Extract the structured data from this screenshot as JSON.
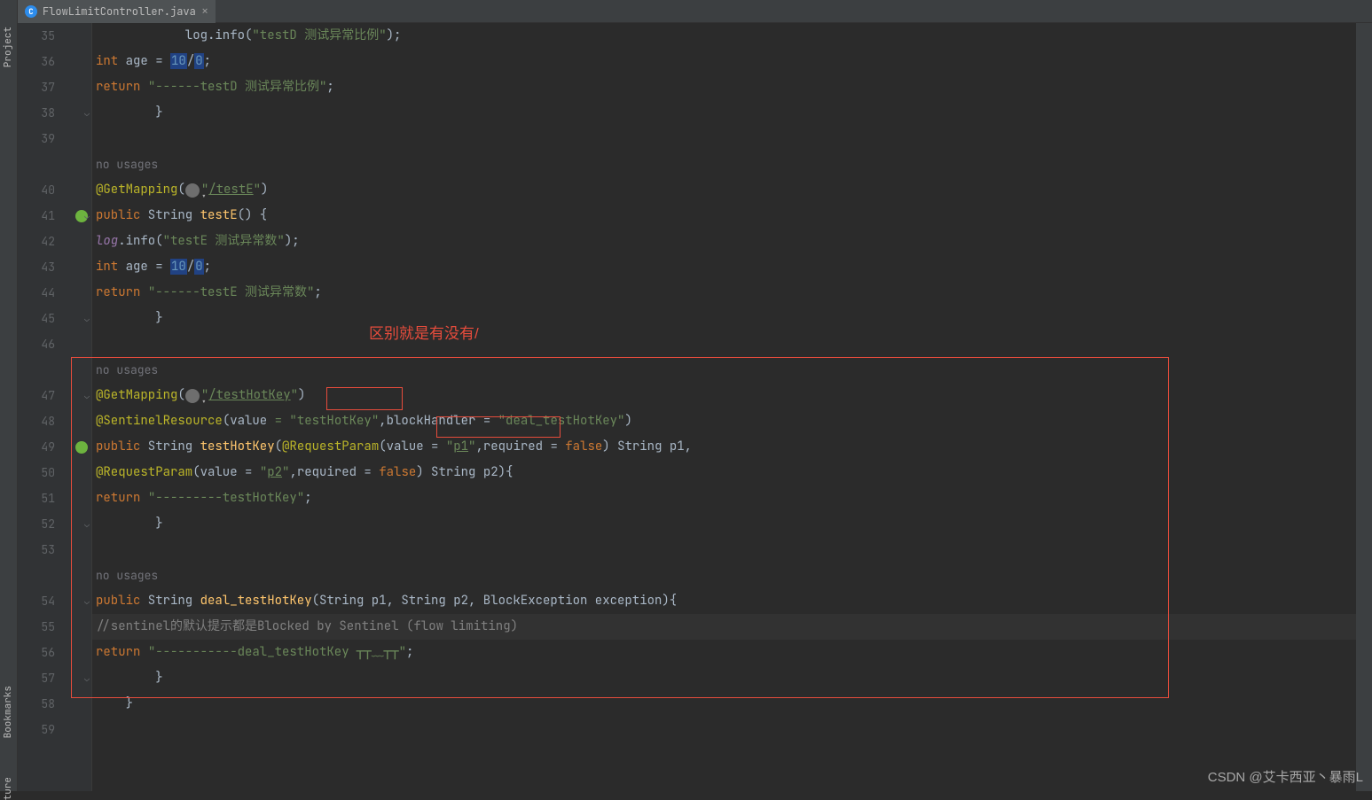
{
  "sidebar": {
    "project": "Project",
    "bookmarks": "Bookmarks",
    "structure": "ture"
  },
  "tab": {
    "filename": "FlowLimitController.java",
    "icon_letter": "C"
  },
  "annotations": {
    "redtext": "区别就是有没有/",
    "watermark": "CSDN @艾卡西亚丶暴雨L"
  },
  "lines": [
    {
      "n": "35",
      "indent": 3,
      "type": "log_info",
      "msg": "\"testD 测试异常比例\""
    },
    {
      "n": "36",
      "indent": 3,
      "type": "int_age"
    },
    {
      "n": "37",
      "indent": 3,
      "type": "return_str",
      "val": "\"------testD 测试异常比例\""
    },
    {
      "n": "38",
      "indent": 2,
      "type": "close_brace",
      "fold": true
    },
    {
      "n": "39",
      "indent": 0,
      "type": "blank"
    },
    {
      "n": "",
      "indent": 2,
      "type": "hint",
      "text": "no usages"
    },
    {
      "n": "40",
      "indent": 2,
      "type": "getmapping",
      "path": "\"/testE\""
    },
    {
      "n": "41",
      "indent": 2,
      "type": "method_sig",
      "name": "testE",
      "params": "",
      "spring": true,
      "fold": true
    },
    {
      "n": "42",
      "indent": 3,
      "type": "log_info_italic",
      "msg": "\"testE 测试异常数\""
    },
    {
      "n": "43",
      "indent": 3,
      "type": "int_age"
    },
    {
      "n": "44",
      "indent": 3,
      "type": "return_str",
      "val": "\"------testE 测试异常数\""
    },
    {
      "n": "45",
      "indent": 2,
      "type": "close_brace",
      "fold": true
    },
    {
      "n": "46",
      "indent": 0,
      "type": "blank"
    },
    {
      "n": "",
      "indent": 2,
      "type": "hint",
      "text": "no usages"
    },
    {
      "n": "47",
      "indent": 2,
      "type": "getmapping",
      "path": "\"/testHotKey\"",
      "fold": true
    },
    {
      "n": "48",
      "indent": 2,
      "type": "sentinel"
    },
    {
      "n": "49",
      "indent": 2,
      "type": "hotkey_sig",
      "spring": true
    },
    {
      "n": "50",
      "indent": 2,
      "type": "hotkey_sig2"
    },
    {
      "n": "51",
      "indent": 3,
      "type": "return_str",
      "val": "\"---------testHotKey\""
    },
    {
      "n": "52",
      "indent": 2,
      "type": "close_brace",
      "fold": true
    },
    {
      "n": "53",
      "indent": 0,
      "type": "blank"
    },
    {
      "n": "",
      "indent": 2,
      "type": "hint",
      "text": "no usages"
    },
    {
      "n": "54",
      "indent": 2,
      "type": "deal_sig",
      "fold": true
    },
    {
      "n": "55",
      "indent": 3,
      "type": "comment",
      "text": "//sentinel的默认提示都是Blocked by Sentinel (flow limiting)",
      "current": true
    },
    {
      "n": "56",
      "indent": 3,
      "type": "return_str",
      "val": "\"-----------deal_testHotKey ┬┬﹏┬┬\""
    },
    {
      "n": "57",
      "indent": 2,
      "type": "close_brace",
      "fold": true
    },
    {
      "n": "58",
      "indent": 1,
      "type": "close_brace_outer"
    },
    {
      "n": "59",
      "indent": 0,
      "type": "blank"
    }
  ]
}
